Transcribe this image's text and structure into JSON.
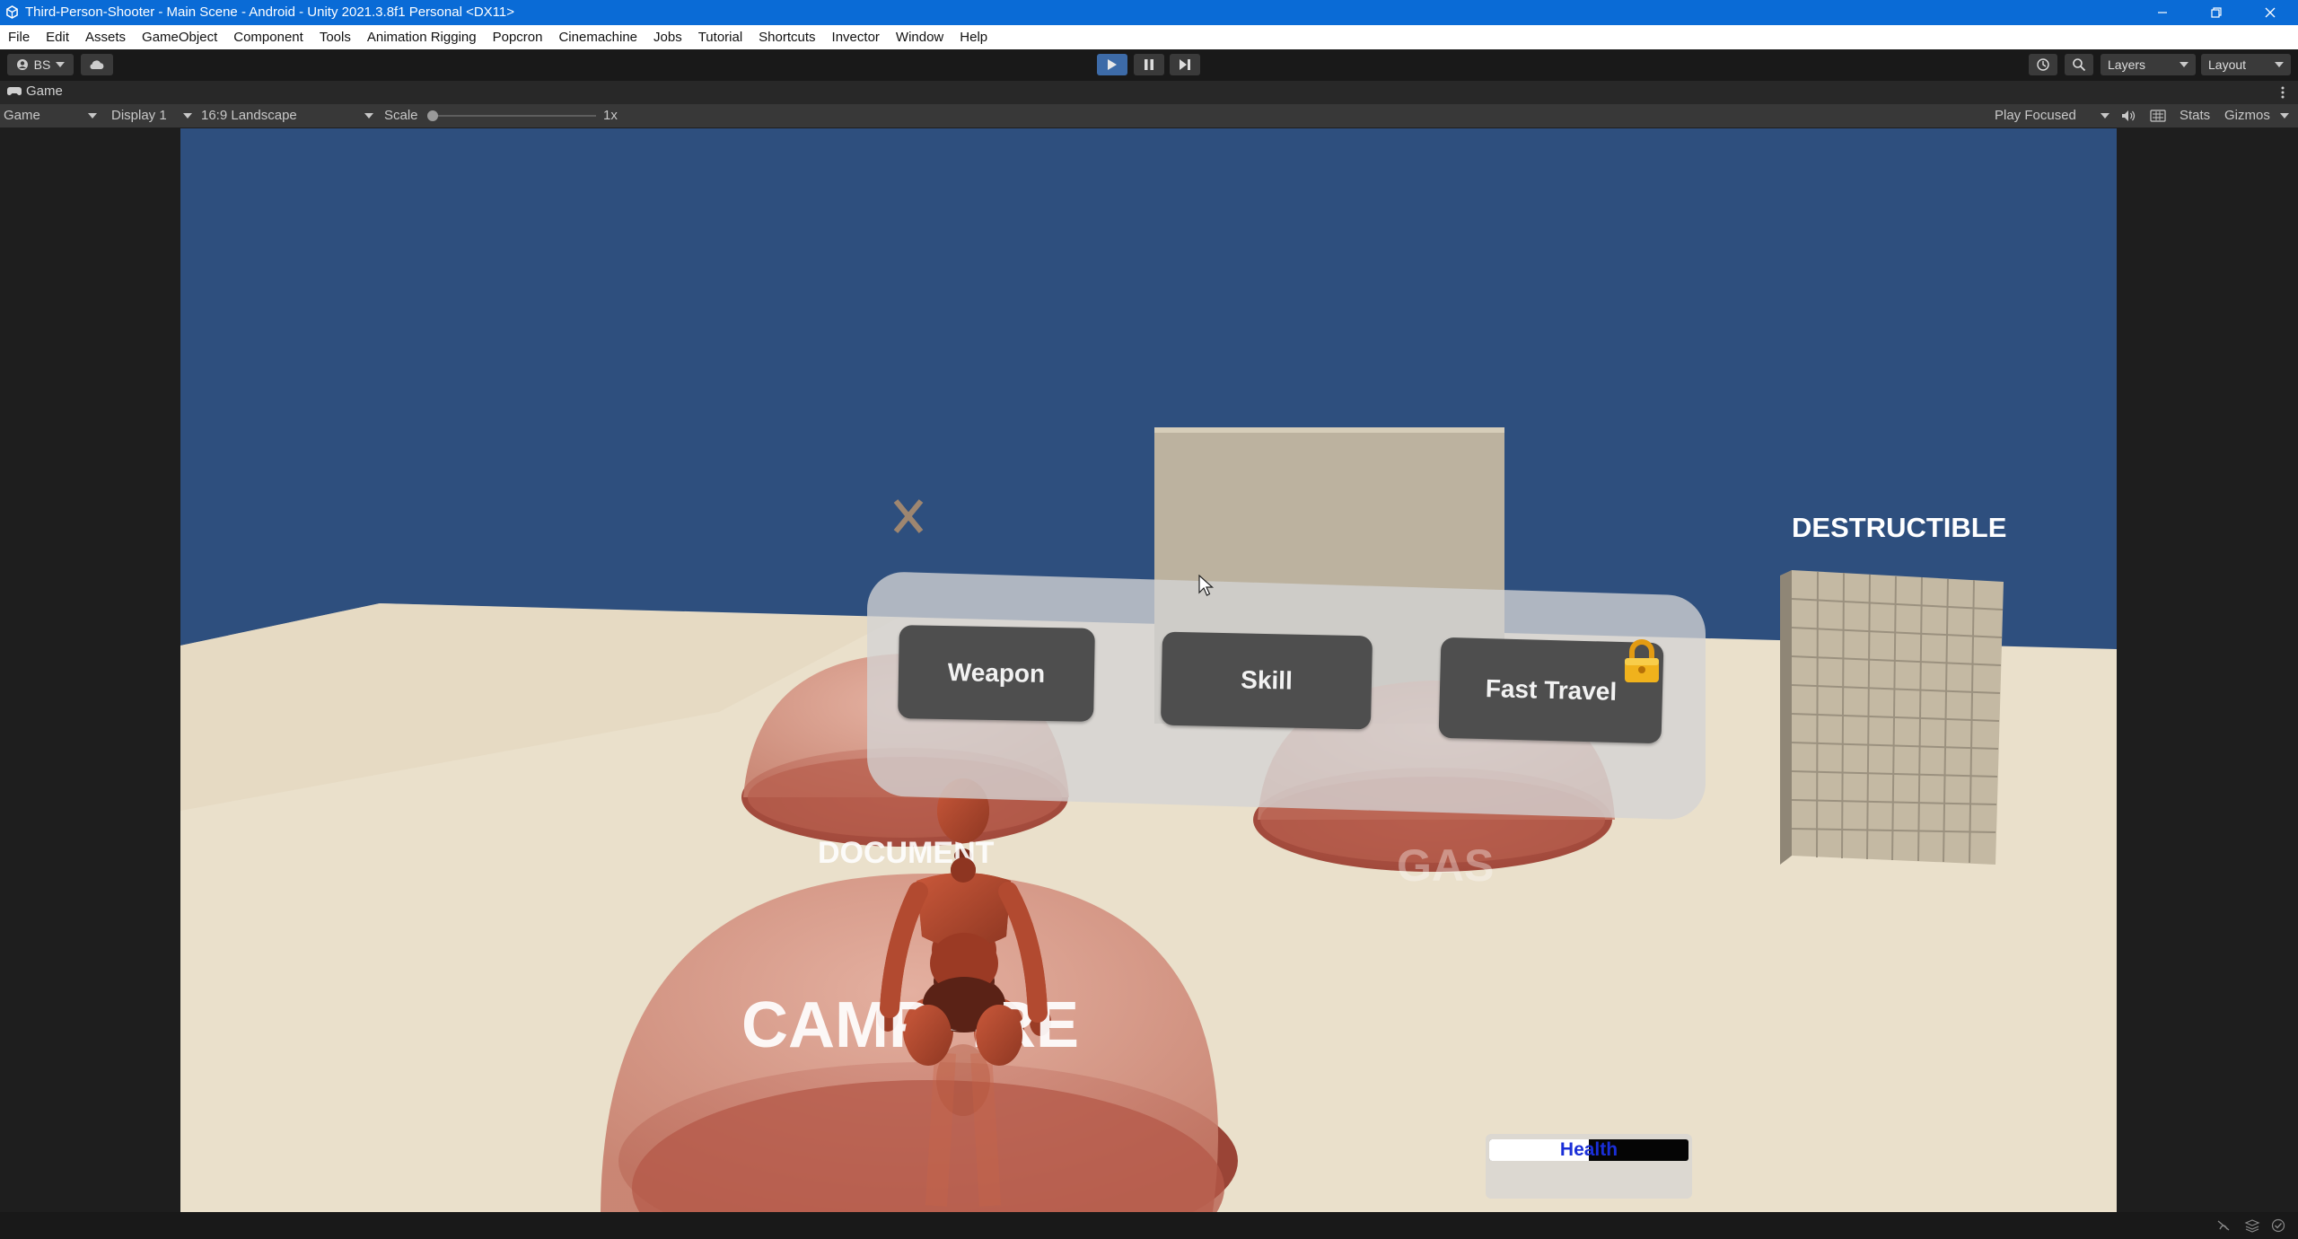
{
  "window": {
    "title": "Third-Person-Shooter - Main Scene - Android - Unity 2021.3.8f1 Personal <DX11>",
    "app_icon": "unity-logo-icon",
    "buttons": [
      "minimize-icon",
      "restore-icon",
      "close-icon"
    ]
  },
  "menu": [
    "File",
    "Edit",
    "Assets",
    "GameObject",
    "Component",
    "Tools",
    "Animation Rigging",
    "Popcron",
    "Cinemachine",
    "Jobs",
    "Tutorial",
    "Shortcuts",
    "Invector",
    "Window",
    "Help"
  ],
  "toolbar": {
    "account_label": "BS",
    "layers_label": "Layers",
    "layout_label": "Layout"
  },
  "tab": {
    "label": "Game"
  },
  "gamebar": {
    "mode": "Game",
    "display": "Display 1",
    "aspect": "16:9 Landscape",
    "scale_label": "Scale",
    "scale_value": "1x",
    "scale_level": 0.0,
    "play_mode": "Play Focused",
    "stats": "Stats",
    "gizmos": "Gizmos"
  },
  "scene": {
    "close_mark": "X",
    "destructible_label": "DESTRUCTIBLE",
    "document_label": "DOCUMENT",
    "gas_label": "GAS",
    "campfire_label": "CAMPFIRE",
    "menu_panel": {
      "weapon_button": "Weapon",
      "skill_button": "Skill",
      "fast_travel_button": "Fast Travel",
      "fast_travel_locked": true
    },
    "health": {
      "label": "Health",
      "fraction": 0.5
    }
  },
  "colors": {
    "titlebar": "#0a6bd6",
    "sky": "#2e4f7e",
    "ground": "#eae0cb",
    "dome": "#cf8a7a",
    "character": "#b4492e",
    "health_text": "#1a2fd8"
  }
}
